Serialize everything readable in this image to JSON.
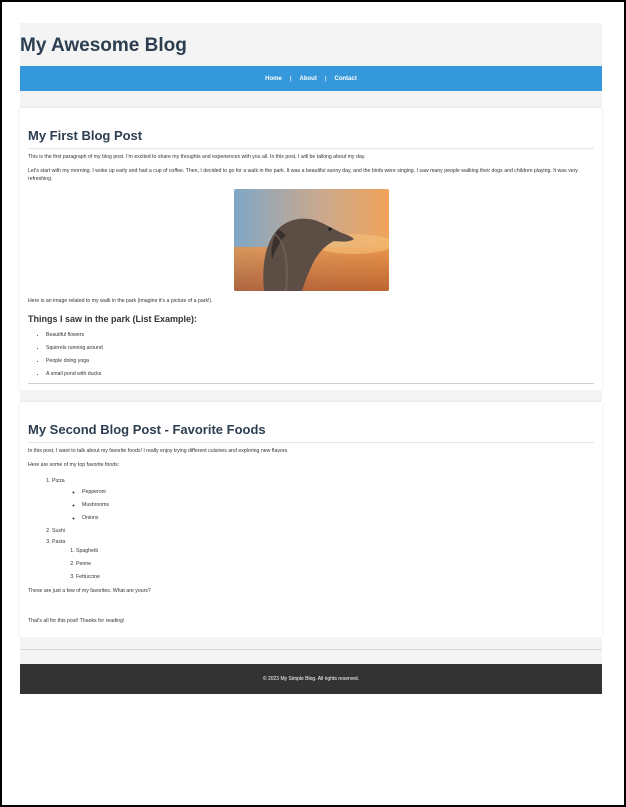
{
  "site": {
    "title": "My Awesome Blog"
  },
  "nav": {
    "items": [
      "Home",
      "About",
      "Contact"
    ],
    "separator": "|"
  },
  "post1": {
    "title": "My First Blog Post",
    "p1": "This is the first paragraph of my blog post. I'm excited to share my thoughts and experiences with you all. In this post, I will be talking about my day.",
    "p2": "Let's start with my morning. I woke up early and had a cup of coffee. Then, I decided to go for a walk in the park. It was a beautiful sunny day, and the birds were singing. I saw many people walking their dogs and children playing. It was very refreshing.",
    "image_caption": "Here is an image related to my walk in the park (imagine it's a picture of a park!).",
    "list_heading": "Things I saw in the park (List Example):",
    "list": [
      "Beautiful flowers",
      "Squirrels running around",
      "People doing yoga",
      "A small pond with ducks"
    ]
  },
  "post2": {
    "title": "My Second Blog Post - Favorite Foods",
    "p1": "In this post, I want to talk about my favorite foods! I really enjoy trying different cuisines and exploring new flavors.",
    "p2": "Here are some of my top favorite foods:",
    "foods": [
      {
        "name": "Pizza",
        "toppings": [
          "Pepperoni",
          "Mushrooms",
          "Onions"
        ]
      },
      {
        "name": "Sushi"
      },
      {
        "name": "Pasta",
        "types": [
          "Spaghetti",
          "Penne",
          "Fettuccine"
        ]
      }
    ],
    "p3": "These are just a few of my favorites. What are yours?",
    "p4": "That's all for this post! Thanks for reading!"
  },
  "footer": {
    "text": "© 2023 My Simple Blog. All rights reserved."
  },
  "colors": {
    "nav": "#3498db",
    "title": "#2c3e50",
    "footer": "#333333"
  }
}
